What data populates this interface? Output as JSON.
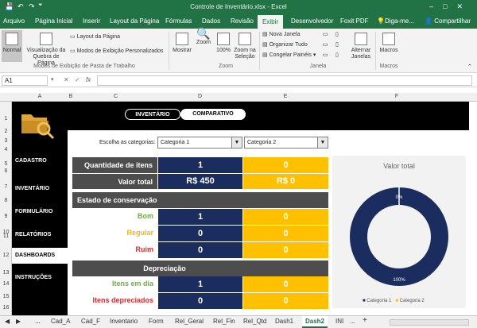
{
  "window": {
    "title": "Controle de Inventário.xlsx - Excel"
  },
  "qat": {
    "autosave": "💾",
    "undo": "↶",
    "redo": "↷",
    "customize": "⏷"
  },
  "ribbon_tabs": [
    "Arquivo",
    "Página Inicial",
    "Inserir",
    "Layout da Página",
    "Fórmulas",
    "Dados",
    "Revisão",
    "Exibir",
    "Desenvolvedor",
    "Foxit PDF"
  ],
  "active_tab": "Exibir",
  "tell_me": "Diga-me...",
  "share": "Compartilhar",
  "ribbon": {
    "normal": "Normal",
    "page_break": "Visualização da Quebra de Página",
    "page_layout": "Layout da Página",
    "custom_views": "Modos de Exibição Personalizados",
    "group1": "Modos de Exibição de Pasta de Trabalho",
    "show": "Mostrar",
    "zoom": "Zoom",
    "zoom100": "100%",
    "zoom_sel": "Zoom na Seleção",
    "group_zoom": "Zoom",
    "new_window": "Nova Janela",
    "arrange_all": "Organizar Tudo",
    "freeze": "Congelar Painéis",
    "switch": "Alternar Janelas",
    "group_window": "Janela",
    "macros": "Macros",
    "group_macros": "Macros"
  },
  "namebox": "A1",
  "fx": "fx",
  "columns": [
    "A",
    "B",
    "C",
    "D",
    "E",
    "F"
  ],
  "rows": [
    "1",
    "2",
    "3",
    "4",
    "5",
    "6",
    "7",
    "8",
    "9",
    "10",
    "11",
    "12",
    "13",
    "14",
    "15",
    "16"
  ],
  "dashboard": {
    "btn_inventory": "INVENTÁRIO",
    "btn_compare": "COMPARATIVO",
    "nav": [
      "CADASTRO",
      "INVENTÁRIO",
      "FORMULÁRIO",
      "RELATÓRIOS",
      "DASHBOARDS",
      "INSTRUÇÕES"
    ],
    "choose_label": "Escolha as categorias:",
    "cat1": "Categoria 1",
    "cat2": "Categoria 2",
    "qty_label": "Quantidade de itens",
    "qty_1": "1",
    "qty_2": "0",
    "total_label": "Valor total",
    "total_1": "R$ 450",
    "total_2": "R$ 0",
    "conservation_header": "Estado de conservação",
    "good_label": "Bom",
    "good_1": "1",
    "good_2": "0",
    "regular_label": "Regular",
    "regular_1": "0",
    "regular_2": "0",
    "bad_label": "Ruim",
    "bad_1": "0",
    "bad_2": "0",
    "depreciation_header": "Depreciação",
    "ontime_label": "Itens em dia",
    "ontime_1": "1",
    "ontime_2": "0",
    "depr_label": "Itens depreciados",
    "depr_1": "0",
    "depr_2": "0"
  },
  "colors": {
    "excel_green": "#217346",
    "navy": "#1b2d5e",
    "gold": "#ffc000",
    "gray_header": "#4d4d4d"
  },
  "chart_data": {
    "type": "pie",
    "title": "Valor total",
    "categories": [
      "Categoria 1",
      "Categoria 2"
    ],
    "values": [
      100,
      0
    ],
    "labels": [
      "100%",
      "0%"
    ],
    "colors": [
      "#1b2d5e",
      "#ffc000"
    ],
    "legend": "bottom"
  },
  "sheet_tabs": [
    "Cad_A",
    "Cad_F",
    "Inventario",
    "Form",
    "Rel_Geral",
    "Rel_Fin",
    "Rel_Qtd",
    "Dash1",
    "Dash2",
    "INI"
  ],
  "active_sheet": "Dash2",
  "sheet_nav": {
    "prev": "◀",
    "next": "▶",
    "more": "...",
    "add": "+"
  }
}
